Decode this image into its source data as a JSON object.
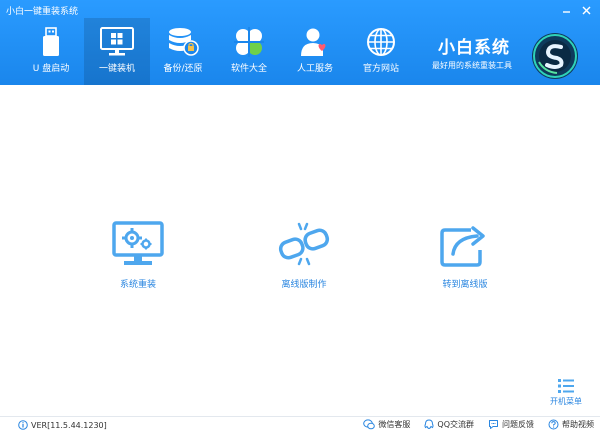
{
  "window": {
    "title": "小白一键重装系统",
    "controls": [
      {
        "name": "minimize",
        "icon": "minimize-icon"
      },
      {
        "name": "close",
        "icon": "close-icon"
      }
    ]
  },
  "nav": {
    "items": [
      {
        "id": "usb-boot",
        "label": "U 盘启动",
        "icon": "usb-drive-icon",
        "active": false
      },
      {
        "id": "one-click",
        "label": "一键装机",
        "icon": "monitor-windows-icon",
        "active": true
      },
      {
        "id": "backup",
        "label": "备份/还原",
        "icon": "database-icon",
        "active": false
      },
      {
        "id": "software",
        "label": "软件大全",
        "icon": "clover-icon",
        "active": false
      },
      {
        "id": "service",
        "label": "人工服务",
        "icon": "person-heart-icon",
        "active": false
      },
      {
        "id": "website",
        "label": "官方网站",
        "icon": "globe-icon",
        "active": false
      }
    ]
  },
  "brand": {
    "name": "小白系统",
    "slogan": "最好用的系统重装工具"
  },
  "actions": [
    {
      "id": "reinstall",
      "label": "系统重装",
      "icon": "monitor-gears-icon"
    },
    {
      "id": "offline",
      "label": "离线版制作",
      "icon": "broken-link-icon"
    },
    {
      "id": "goto-offline",
      "label": "转到离线版",
      "icon": "share-arrow-icon"
    }
  ],
  "boot_menu": {
    "label": "开机菜单",
    "icon": "list-icon"
  },
  "footer": {
    "version": "VER[11.5.44.1230]",
    "links": [
      {
        "id": "wechat",
        "label": "微信客服",
        "icon": "wechat-icon"
      },
      {
        "id": "qq",
        "label": "QQ交流群",
        "icon": "qq-icon"
      },
      {
        "id": "feedback",
        "label": "问题反馈",
        "icon": "feedback-icon"
      },
      {
        "id": "help",
        "label": "帮助视频",
        "icon": "help-icon"
      }
    ]
  },
  "colors": {
    "header": "#1a86ec",
    "accent": "#2a86e0",
    "icon_blue": "#4ea7ee",
    "background": "#ffffff"
  }
}
